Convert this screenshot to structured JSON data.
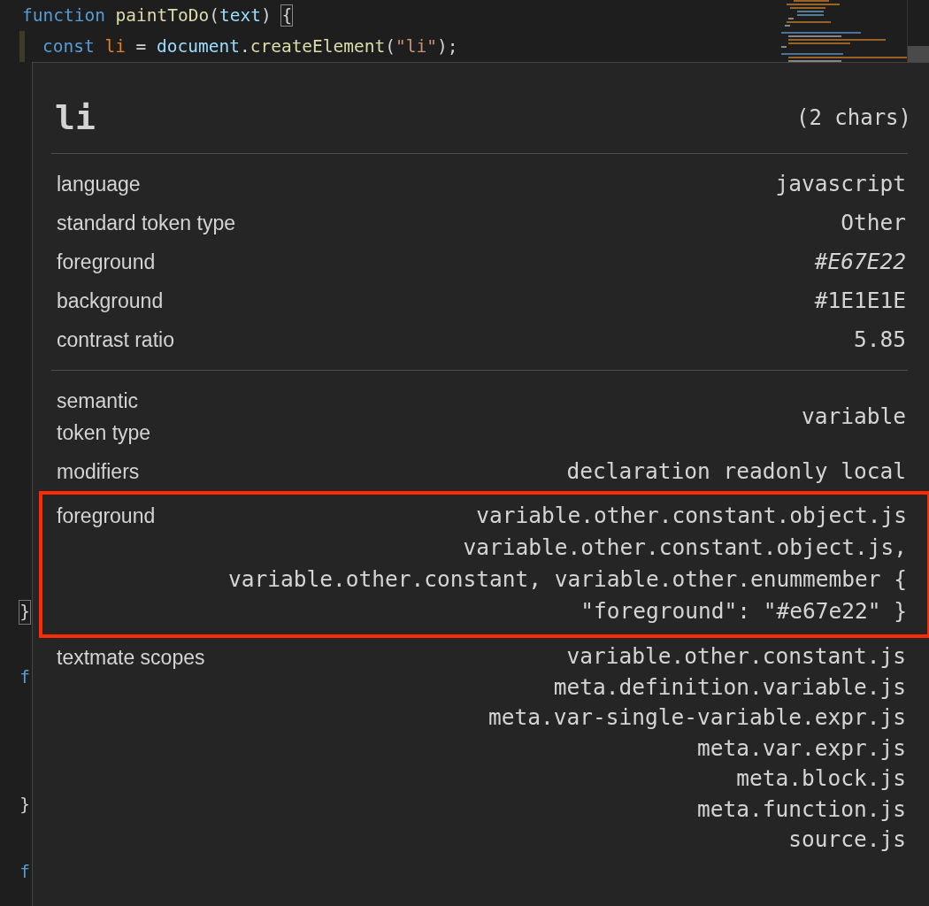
{
  "code_lines": [
    {
      "tokens": [
        {
          "kind": "keyword",
          "text": "function"
        },
        {
          "kind": "function",
          "text": "paintToDo",
          "space_before": true
        },
        {
          "kind": "plain",
          "text": "("
        },
        {
          "kind": "param",
          "text": "text"
        },
        {
          "kind": "plain",
          "text": ")"
        },
        {
          "kind": "bracket",
          "text": "{",
          "space_before": true
        }
      ]
    },
    {
      "tokens": [
        {
          "kind": "keyword",
          "text": "const"
        },
        {
          "kind": "constant",
          "text": "li",
          "space_before": true
        },
        {
          "kind": "plain",
          "text": "=",
          "space_before": true
        },
        {
          "kind": "param",
          "text": "document",
          "space_before": true
        },
        {
          "kind": "plain",
          "text": "."
        },
        {
          "kind": "function",
          "text": "createElement"
        },
        {
          "kind": "plain",
          "text": "("
        },
        {
          "kind": "string",
          "text": "\"li\""
        },
        {
          "kind": "plain",
          "text": ");"
        }
      ]
    }
  ],
  "gutter_fragments": [
    {
      "kind": "bracket",
      "text": "}"
    },
    {
      "kind": "keyword",
      "text": "f"
    },
    {
      "kind": "plain",
      "text": "}"
    },
    {
      "kind": "keyword",
      "text": "f"
    }
  ],
  "hover": {
    "token": "li",
    "length": "(2 chars)",
    "sections": [
      [
        {
          "label": "language",
          "value": [
            "javascript"
          ],
          "italic": false,
          "highlighted": false
        },
        {
          "label": "standard token type",
          "value": [
            "Other"
          ],
          "italic": false,
          "highlighted": false
        },
        {
          "label": "foreground",
          "value": [
            "#E67E22"
          ],
          "italic": true,
          "highlighted": false
        },
        {
          "label": "background",
          "value": [
            "#1E1E1E"
          ],
          "italic": false,
          "highlighted": false
        },
        {
          "label": "contrast ratio",
          "value": [
            "5.85"
          ],
          "italic": false,
          "highlighted": false
        }
      ],
      [
        {
          "label": "semantic token type",
          "value": [
            "variable"
          ],
          "italic": false,
          "highlighted": false
        },
        {
          "label": "modifiers",
          "value": [
            "declaration readonly local"
          ],
          "italic": false,
          "highlighted": false
        },
        {
          "label": "foreground",
          "value": [
            "variable.other.constant.object.js",
            "variable.other.constant.object.js,",
            "variable.other.constant, variable.other.enummember {",
            "\"foreground\": \"#e67e22\" }"
          ],
          "italic": false,
          "highlighted": true
        },
        {
          "label": "textmate scopes",
          "value": [
            "variable.other.constant.js",
            "meta.definition.variable.js",
            "meta.var-single-variable.expr.js",
            "meta.var.expr.js",
            "meta.block.js",
            "meta.function.js",
            "source.js"
          ],
          "italic": false,
          "highlighted": false
        }
      ]
    ]
  }
}
